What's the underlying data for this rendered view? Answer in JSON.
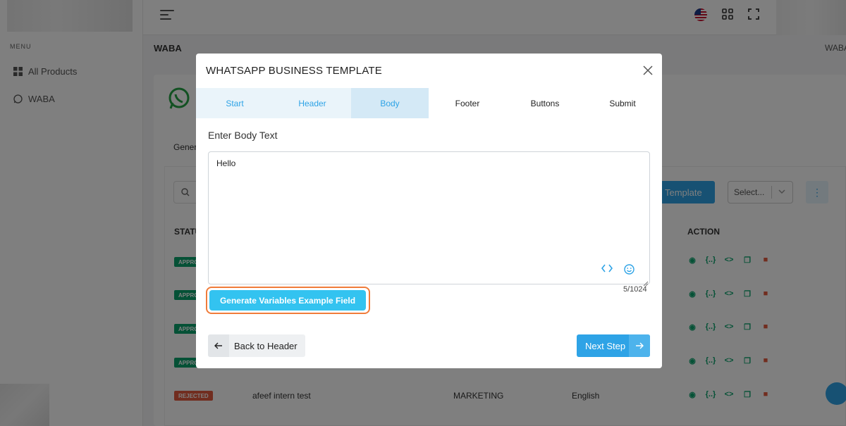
{
  "sidebar": {
    "menu_title": "MENU",
    "items": [
      {
        "label": "All Products",
        "icon": "grid-icon"
      },
      {
        "label": "WABA",
        "icon": "whatsapp-icon"
      }
    ]
  },
  "header": {
    "page_title": "WABA",
    "breadcrumb": "WABA"
  },
  "background": {
    "tab_label": "Gener",
    "create_button_label": "Template",
    "filter_placeholder": "Select...",
    "columns": [
      "STATU",
      "ACTION"
    ],
    "rows": [
      {
        "status": "APPRO"
      },
      {
        "status": "APPRO"
      },
      {
        "status": "APPRO"
      },
      {
        "status": "APPRO"
      },
      {
        "status": "REJECTED",
        "name": "afeef intern test",
        "category": "MARKETING",
        "language": "English"
      }
    ],
    "action_icons": [
      "eye-icon",
      "variables-icon",
      "code-icon",
      "copy-icon",
      "delete-icon"
    ]
  },
  "modal": {
    "title": "WHATSAPP BUSINESS TEMPLATE",
    "steps": [
      {
        "label": "Start",
        "state": "done"
      },
      {
        "label": "Header",
        "state": "done"
      },
      {
        "label": "Body",
        "state": "active"
      },
      {
        "label": "Footer",
        "state": "future"
      },
      {
        "label": "Buttons",
        "state": "future"
      },
      {
        "label": "Submit",
        "state": "future"
      }
    ],
    "body_label": "Enter Body Text",
    "body_value": "Hello",
    "char_count": "5/1024",
    "generate_button": "Generate Variables Example Field",
    "back_button": "Back to Header",
    "next_button": "Next Step"
  },
  "colors": {
    "primary": "#2ea3e6",
    "generate_button": "#33c3f0",
    "highlight_outline": "#f07c3a",
    "approved": "#0aa36c",
    "rejected": "#e25a3e"
  }
}
